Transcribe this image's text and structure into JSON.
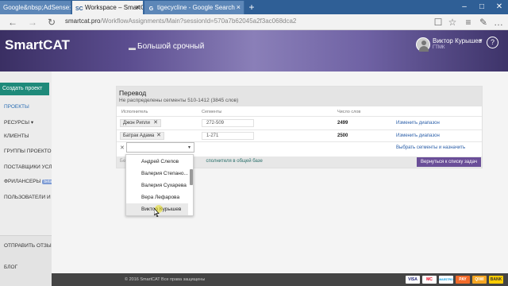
{
  "browser": {
    "tabs": [
      {
        "label": "Google&nbsp;AdSense: np",
        "favicon": "G"
      },
      {
        "label": "Workspace – SmartCAT",
        "favicon": "SC"
      },
      {
        "label": "tigecycline - Google Search",
        "favicon": "G"
      }
    ],
    "url_host": "smartcat.pro",
    "url_path": "/WorkflowAssignments/Main?sessionId=570a7b62045a2f3ac068dca2"
  },
  "header": {
    "logo": "SmartCAT",
    "breadcrumb": "Большой срочный",
    "user_name": "Виктор Курышев",
    "user_org": "ГТМК",
    "help": "?"
  },
  "sidebar": {
    "create_button": "Создать проект",
    "items": [
      {
        "label": "ПРОЕКТЫ",
        "active": true
      },
      {
        "label": "РЕСУРСЫ",
        "has_caret": true
      },
      {
        "label": "КЛИЕНТЫ"
      },
      {
        "label": "ГРУППЫ ПРОЕКТОВ"
      },
      {
        "label": "ПОСТАВЩИКИ УСЛУГ"
      },
      {
        "label": "ФРИЛАНСЕРЫ",
        "badge": "beta"
      },
      {
        "label": "ПОЛЬЗОВАТЕЛИ И ПРАВА"
      }
    ],
    "feedback": "ОТПРАВИТЬ ОТЗЫВ",
    "blog": "БЛОГ"
  },
  "panel": {
    "title": "Перевод",
    "subtitle": "Не распределены сегменты 510-1412 (3845 слов)",
    "columns": [
      "Исполнитель",
      "Сегменты",
      "Число слов"
    ],
    "rows": [
      {
        "assignee": "Джон Рипли",
        "segments": "272-509",
        "words": "2499",
        "action": "Изменить диапазон"
      },
      {
        "assignee": "Батрак Адама",
        "segments": "1-271",
        "words": "2500",
        "action": "Изменить диапазон"
      }
    ],
    "select_action": "Выбрать сегменты и назначить",
    "footer_partial": "Бесп",
    "footer_link": "сполнителя в общей базе",
    "back_button": "Вернуться к списку задач"
  },
  "dropdown": {
    "options": [
      "Андрей Слепов",
      "Валерия Степано...",
      "Валерия Сухарева",
      "Вера Лефарова",
      "Виктор Курышев"
    ],
    "hovered_index": 4
  },
  "footer": {
    "copyright": "© 2016 SmartCAT Все права защищены",
    "payments": [
      "VISA",
      "MC",
      "MAESTRO",
      "PAY",
      "QIWI",
      "BANK"
    ]
  },
  "colors": {
    "accent": "#1f8a7a",
    "link": "#2a5ea8",
    "primary_button": "#6a4e98",
    "tabstrip": "#2f5f96"
  }
}
